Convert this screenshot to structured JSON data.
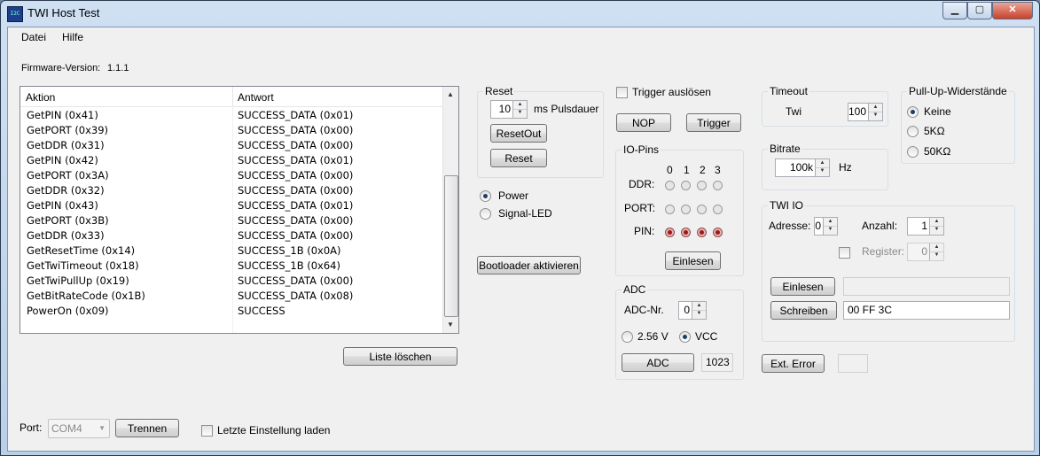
{
  "window": {
    "title": "TWI Host Test",
    "app_icon_text": "I2C",
    "controls": {
      "minimize": "▁",
      "maximize": "▢",
      "close": "✕"
    }
  },
  "menu": {
    "file": "Datei",
    "help": "Hilfe"
  },
  "firmware": {
    "label": "Firmware-Version:",
    "value": "1.1.1"
  },
  "log": {
    "columns": [
      "Aktion",
      "Antwort"
    ],
    "rows": [
      {
        "action": "GetPIN (0x41)",
        "response": "SUCCESS_DATA (0x01)"
      },
      {
        "action": "GetPORT (0x39)",
        "response": "SUCCESS_DATA (0x00)"
      },
      {
        "action": "GetDDR (0x31)",
        "response": "SUCCESS_DATA (0x00)"
      },
      {
        "action": "GetPIN (0x42)",
        "response": "SUCCESS_DATA (0x01)"
      },
      {
        "action": "GetPORT (0x3A)",
        "response": "SUCCESS_DATA (0x00)"
      },
      {
        "action": "GetDDR (0x32)",
        "response": "SUCCESS_DATA (0x00)"
      },
      {
        "action": "GetPIN (0x43)",
        "response": "SUCCESS_DATA (0x01)"
      },
      {
        "action": "GetPORT (0x3B)",
        "response": "SUCCESS_DATA (0x00)"
      },
      {
        "action": "GetDDR (0x33)",
        "response": "SUCCESS_DATA (0x00)"
      },
      {
        "action": "GetResetTime (0x14)",
        "response": "SUCCESS_1B (0x0A)"
      },
      {
        "action": "GetTwiTimeout (0x18)",
        "response": "SUCCESS_1B (0x64)"
      },
      {
        "action": "GetTwiPullUp (0x19)",
        "response": "SUCCESS_DATA (0x00)"
      },
      {
        "action": "GetBitRateCode (0x1B)",
        "response": "SUCCESS_DATA (0x08)"
      },
      {
        "action": "PowerOn (0x09)",
        "response": "SUCCESS"
      }
    ],
    "clear_button": "Liste löschen"
  },
  "port": {
    "label": "Port:",
    "value": "COM4",
    "disconnect_button": "Trennen",
    "load_last_label": "Letzte Einstellung laden",
    "load_last_checked": false
  },
  "reset": {
    "title": "Reset",
    "pulse_value": "10",
    "pulse_unit": "ms Pulsdauer",
    "reset_out_button": "ResetOut",
    "reset_button": "Reset"
  },
  "status": {
    "power_label": "Power",
    "power_on": true,
    "signal_led_label": "Signal-LED",
    "signal_led_on": false
  },
  "bootloader_button": "Bootloader aktivieren",
  "trigger": {
    "checkbox_label": "Trigger auslösen",
    "checked": false,
    "nop_button": "NOP",
    "trigger_button": "Trigger"
  },
  "io_pins": {
    "title": "IO-Pins",
    "bit_labels": [
      "0",
      "1",
      "2",
      "3"
    ],
    "ddr_label": "DDR:",
    "port_label": "PORT:",
    "pin_label": "PIN:",
    "ddr": [
      false,
      false,
      false,
      false
    ],
    "port": [
      false,
      false,
      false,
      false
    ],
    "pin": [
      true,
      true,
      true,
      true
    ],
    "read_button": "Einlesen"
  },
  "adc": {
    "title": "ADC",
    "channel_label": "ADC-Nr.",
    "channel_value": "0",
    "ref_256_label": "2.56 V",
    "ref_vcc_label": "VCC",
    "ref_selected": "VCC",
    "button": "ADC",
    "value": "1023"
  },
  "timeout": {
    "title": "Timeout",
    "label": "Twi",
    "value": "100"
  },
  "bitrate": {
    "title": "Bitrate",
    "value": "100k",
    "unit": "Hz"
  },
  "pullup": {
    "title": "Pull-Up-Widerstände",
    "options": [
      "Keine",
      "5KΩ",
      "50KΩ"
    ],
    "selected": "Keine"
  },
  "twi_io": {
    "title": "TWI IO",
    "address_label": "Adresse:",
    "address_value": "0",
    "count_label": "Anzahl:",
    "count_value": "1",
    "register_label": "Register:",
    "register_value": "0",
    "register_checked": false,
    "read_button": "Einlesen",
    "read_result": "",
    "write_button": "Schreiben",
    "write_value": "00 FF 3C"
  },
  "ext_error": {
    "button": "Ext. Error",
    "value": ""
  }
}
